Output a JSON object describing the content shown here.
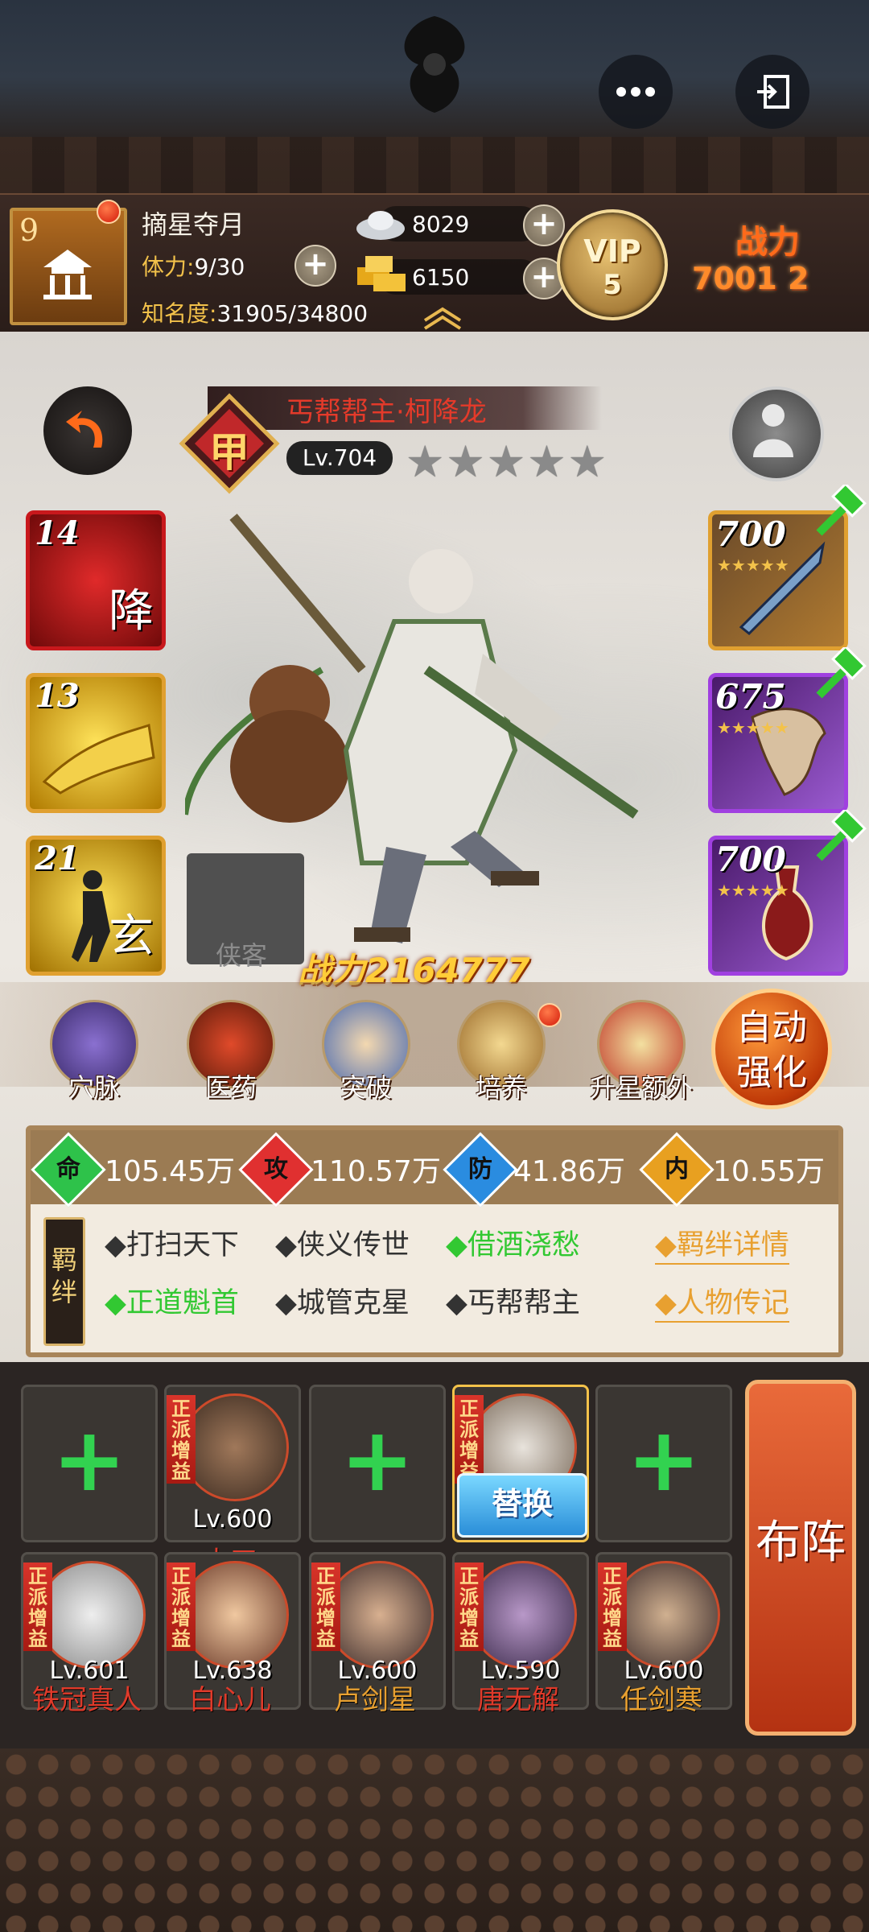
{
  "player": {
    "level": "9",
    "name": "摘星夺月",
    "stamina_label": "体力:",
    "stamina_value": "9/30",
    "fame_label": "知名度:",
    "fame_value": "31905/34800",
    "silver": "8029",
    "gold": "6150",
    "vip_label": "VIP",
    "vip_level": "5",
    "power_label": "战力",
    "power_value": "7001 2"
  },
  "hero": {
    "title": "丐帮帮主·柯降龙",
    "rank_char": "甲",
    "level": "Lv.704",
    "stars": "★★★★★",
    "total_power": "战力2164777"
  },
  "skills": [
    {
      "num": "14",
      "char": "降",
      "color": "#b0121a"
    },
    {
      "num": "13",
      "char": "",
      "color": "#d89a10"
    },
    {
      "num": "21",
      "char": "玄",
      "color": "#d89a10"
    }
  ],
  "empty_slot_label": "侠客",
  "equipment": [
    {
      "num": "700",
      "stars": "★★★★★",
      "color": "#d59a2c"
    },
    {
      "num": "675",
      "stars": "★★★★★",
      "color": "#7a2ab0"
    },
    {
      "num": "700",
      "stars": "★★★★★",
      "color": "#7a2ab0"
    }
  ],
  "functions": [
    {
      "label": "穴脉"
    },
    {
      "label": "医药"
    },
    {
      "label": "突破"
    },
    {
      "label": "培养"
    },
    {
      "label": "升星额外"
    }
  ],
  "auto_enhance": {
    "line1": "自动",
    "line2": "强化"
  },
  "stats": [
    {
      "icon": "命",
      "value": "105.45万",
      "color": "#2ec24a"
    },
    {
      "icon": "攻",
      "value": "110.57万",
      "color": "#e03030"
    },
    {
      "icon": "防",
      "value": "41.86万",
      "color": "#2a8ce0"
    },
    {
      "icon": "内",
      "value": "10.55万",
      "color": "#e8a020"
    }
  ],
  "bond_tag": "羁绊",
  "bonds_row1": [
    {
      "text": "◆打扫天下",
      "active": false
    },
    {
      "text": "◆侠义传世",
      "active": false
    },
    {
      "text": "◆借酒浇愁",
      "active": true
    }
  ],
  "bonds_row2": [
    {
      "text": "◆正道魁首",
      "active": true
    },
    {
      "text": "◆城管克星",
      "active": false
    },
    {
      "text": "◆丐帮帮主",
      "active": false
    }
  ],
  "links": {
    "bond_detail": "◆羁绊详情",
    "biography": "◆人物传记"
  },
  "team_row1": [
    {
      "type": "empty"
    },
    {
      "type": "member",
      "boost": "正派增益",
      "level": "Lv.600",
      "name": "火工",
      "name_color": "#e03a2a"
    },
    {
      "type": "empty"
    },
    {
      "type": "member",
      "boost": "正派增益",
      "level": "",
      "name": "",
      "name_color": "#ffffff"
    },
    {
      "type": "empty"
    }
  ],
  "replace_label": "替换",
  "team_row2": [
    {
      "boost": "正派增益",
      "level": "Lv.601",
      "name": "铁冠真人",
      "name_color": "#e03a2a"
    },
    {
      "boost": "正派增益",
      "level": "Lv.638",
      "name": "白心儿",
      "name_color": "#e03a2a"
    },
    {
      "boost": "正派增益",
      "level": "Lv.600",
      "name": "卢剑星",
      "name_color": "#e8a030"
    },
    {
      "boost": "正派增益",
      "level": "Lv.590",
      "name": "唐无解",
      "name_color": "#e03a2a"
    },
    {
      "boost": "正派增益",
      "level": "Lv.600",
      "name": "任剑寒",
      "name_color": "#e8a030"
    }
  ],
  "formation_label": "布阵"
}
